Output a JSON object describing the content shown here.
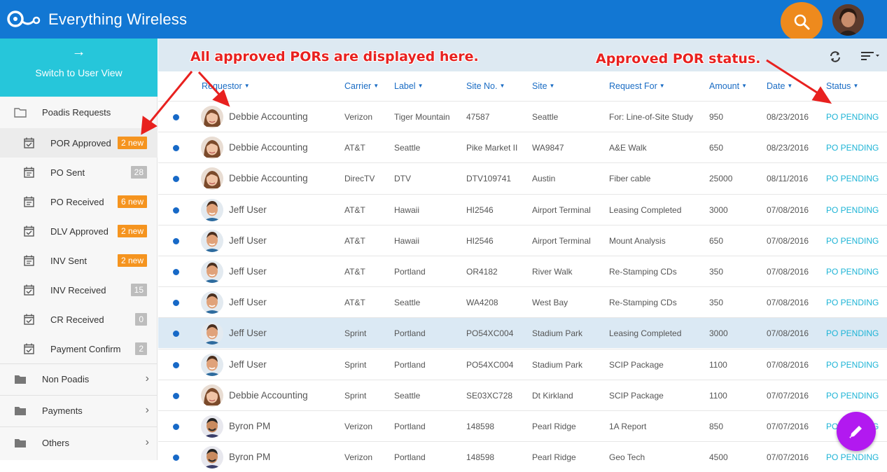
{
  "app": {
    "title": "Everything Wireless"
  },
  "sidebar": {
    "switch_label": "Switch to User View",
    "switch_arrow": "→",
    "group_title": "Poadis Requests",
    "items": [
      {
        "label": "POR Approved",
        "badge": "2 new",
        "badge_type": "new"
      },
      {
        "label": "PO Sent",
        "badge": "28",
        "badge_type": "count"
      },
      {
        "label": "PO Received",
        "badge": "6 new",
        "badge_type": "new"
      },
      {
        "label": "DLV Approved",
        "badge": "2 new",
        "badge_type": "new"
      },
      {
        "label": "INV Sent",
        "badge": "2 new",
        "badge_type": "new"
      },
      {
        "label": "INV Received",
        "badge": "15",
        "badge_type": "count"
      },
      {
        "label": "CR Received",
        "badge": "0",
        "badge_type": "count"
      },
      {
        "label": "Payment Confirm",
        "badge": "2",
        "badge_type": "count"
      }
    ],
    "other_groups": [
      "Non Poadis",
      "Payments",
      "Others"
    ]
  },
  "table": {
    "headers": [
      "Requestor",
      "Carrier",
      "Label",
      "Site No.",
      "Site",
      "Request For",
      "Amount",
      "Date",
      "Status"
    ],
    "rows": [
      {
        "requestor": "Debbie Accounting",
        "carrier": "Verizon",
        "label": "Tiger Mountain",
        "site_no": "47587",
        "site": "Seattle",
        "request_for": "For: Line-of-Site Study",
        "amount": "950",
        "date": "08/23/2016",
        "status": "PO PENDING",
        "avatar": "female"
      },
      {
        "requestor": "Debbie Accounting",
        "carrier": "AT&T",
        "label": "Seattle",
        "site_no": "Pike Market II",
        "site": "WA9847",
        "request_for": "A&E Walk",
        "amount": "650",
        "date": "08/23/2016",
        "status": "PO PENDING",
        "avatar": "female"
      },
      {
        "requestor": "Debbie Accounting",
        "carrier": "DirecTV",
        "label": "DTV",
        "site_no": "DTV109741",
        "site": "Austin",
        "request_for": "Fiber cable",
        "amount": "25000",
        "date": "08/11/2016",
        "status": "PO PENDING",
        "avatar": "female"
      },
      {
        "requestor": "Jeff User",
        "carrier": "AT&T",
        "label": "Hawaii",
        "site_no": "HI2546",
        "site": "Airport Terminal",
        "request_for": "Leasing Completed",
        "amount": "3000",
        "date": "07/08/2016",
        "status": "PO PENDING",
        "avatar": "male"
      },
      {
        "requestor": "Jeff User",
        "carrier": "AT&T",
        "label": "Hawaii",
        "site_no": "HI2546",
        "site": "Airport Terminal",
        "request_for": "Mount Analysis",
        "amount": "650",
        "date": "07/08/2016",
        "status": "PO PENDING",
        "avatar": "male"
      },
      {
        "requestor": "Jeff User",
        "carrier": "AT&T",
        "label": "Portland",
        "site_no": "OR4182",
        "site": "River Walk",
        "request_for": "Re-Stamping CDs",
        "amount": "350",
        "date": "07/08/2016",
        "status": "PO PENDING",
        "avatar": "male"
      },
      {
        "requestor": "Jeff User",
        "carrier": "AT&T",
        "label": "Seattle",
        "site_no": "WA4208",
        "site": "West Bay",
        "request_for": "Re-Stamping CDs",
        "amount": "350",
        "date": "07/08/2016",
        "status": "PO PENDING",
        "avatar": "male"
      },
      {
        "requestor": "Jeff User",
        "carrier": "Sprint",
        "label": "Portland",
        "site_no": "PO54XC004",
        "site": "Stadium Park",
        "request_for": "Leasing Completed",
        "amount": "3000",
        "date": "07/08/2016",
        "status": "PO PENDING",
        "avatar": "male"
      },
      {
        "requestor": "Jeff User",
        "carrier": "Sprint",
        "label": "Portland",
        "site_no": "PO54XC004",
        "site": "Stadium Park",
        "request_for": "SCIP Package",
        "amount": "1100",
        "date": "07/08/2016",
        "status": "PO PENDING",
        "avatar": "male"
      },
      {
        "requestor": "Debbie Accounting",
        "carrier": "Sprint",
        "label": "Seattle",
        "site_no": "SE03XC728",
        "site": "Dt Kirkland",
        "request_for": "SCIP Package",
        "amount": "1100",
        "date": "07/07/2016",
        "status": "PO PENDING",
        "avatar": "female"
      },
      {
        "requestor": "Byron PM",
        "carrier": "Verizon",
        "label": "Portland",
        "site_no": "148598",
        "site": "Pearl Ridge",
        "request_for": "1A Report",
        "amount": "850",
        "date": "07/07/2016",
        "status": "PO PENDING",
        "avatar": "male2"
      },
      {
        "requestor": "Byron PM",
        "carrier": "Verizon",
        "label": "Portland",
        "site_no": "148598",
        "site": "Pearl Ridge",
        "request_for": "Geo Tech",
        "amount": "4500",
        "date": "07/07/2016",
        "status": "PO PENDING",
        "avatar": "male2"
      }
    ],
    "selected_row": 7
  },
  "annotations": {
    "left": "All approved PORs are displayed here.",
    "right": "Approved POR status."
  },
  "colors": {
    "brand": "#1277d3",
    "accent": "#26c6da",
    "status": "#1eb4d6",
    "badge_new": "#f5941f",
    "fab": "#b219f0"
  },
  "icons": {
    "search": "search-icon",
    "refresh": "refresh-icon",
    "sort": "sort-icon",
    "edit": "pencil-icon"
  }
}
